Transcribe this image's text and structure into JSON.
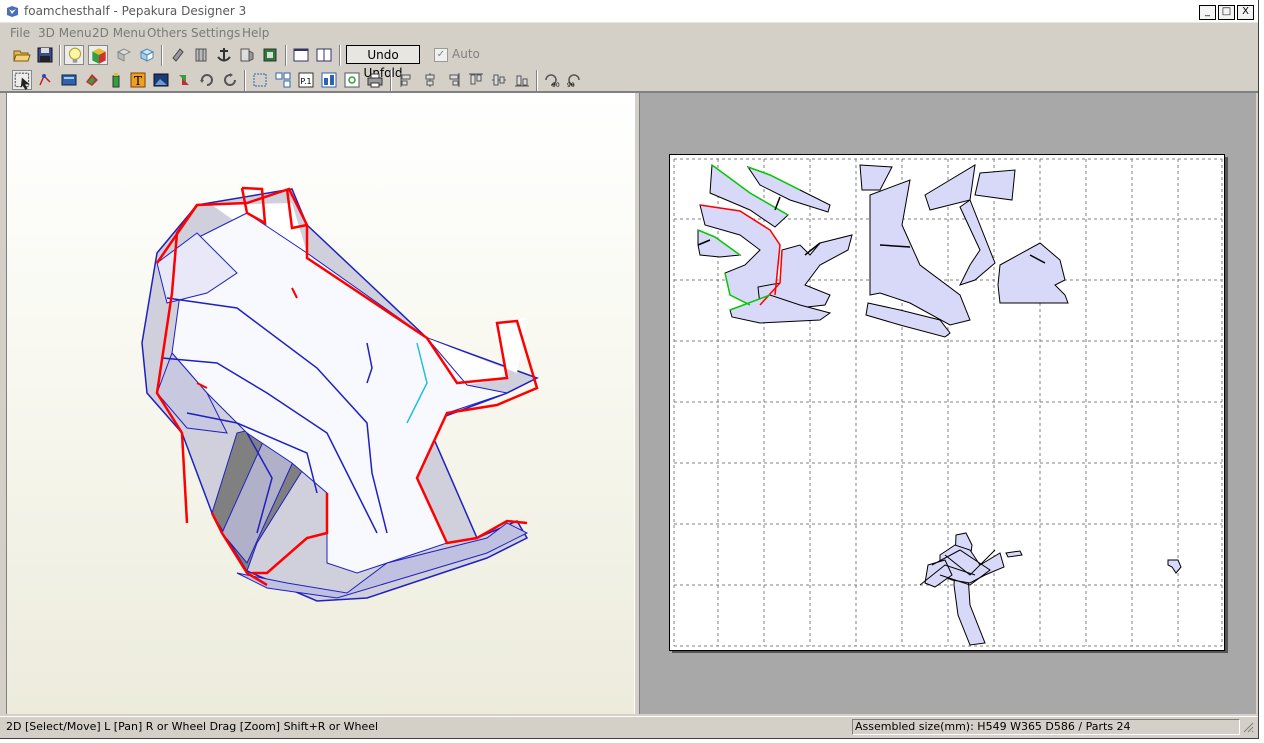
{
  "window": {
    "title": "foamchesthalf - Pepakura Designer 3",
    "controls": [
      "_",
      "□",
      "X"
    ]
  },
  "menu": [
    "File",
    "3D Menu",
    "2D Menu",
    "Others",
    "Settings",
    "Help"
  ],
  "toolbar": {
    "undo_unfold_label": "Undo Unfold",
    "auto_label": "Auto",
    "auto_checked": true,
    "row1_icons": [
      "open-icon",
      "save-icon",
      "lightbulb-icon",
      "texture-cube-icon",
      "edge-icon",
      "model-cube-icon",
      "eraser-icon",
      "pillar-icon",
      "anchor-icon",
      "flap-icon",
      "join-icon",
      "single-view-icon",
      "split-view-icon"
    ],
    "row2_icons": [
      "select-icon",
      "edit-icon",
      "texture-icon",
      "paint-icon",
      "glue-icon",
      "text-icon",
      "image-icon",
      "move-icon",
      "rotate-icon",
      "unfold-icon",
      "fit-icon",
      "arrange-icon",
      "page-number-icon",
      "page-layout-icon",
      "print-preview-icon",
      "print-icon",
      "align-left-icon",
      "align-center-icon",
      "align-right-icon",
      "align-top-icon",
      "align-middle-icon",
      "align-bottom-icon",
      "rotate-left-90-icon",
      "rotate-right-90-icon"
    ]
  },
  "status": {
    "hint": "2D [Select/Move] L [Pan] R or Wheel Drag [Zoom] Shift+R or Wheel",
    "assembled": "Assembled size(mm): H549 W365 D586 / Parts 24"
  },
  "colors": {
    "cut_edge": "#ff0000",
    "fold_edge": "#0000cc",
    "mountain": "#00cc00",
    "part_fill": "#d8d8f8",
    "paper_bg": "#a8a8a8"
  }
}
